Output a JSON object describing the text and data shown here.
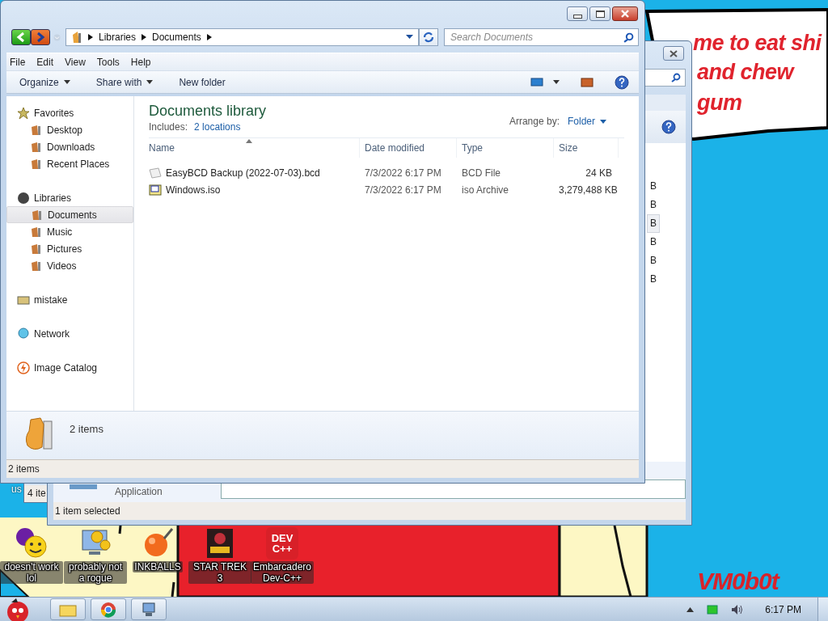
{
  "wallpaper": {
    "sign_lines": [
      "me to eat shi",
      "and chew",
      "gum"
    ],
    "signature": "VM0b0t"
  },
  "desktop": {
    "hidden_icon_label": "us",
    "icons": [
      {
        "label": "doesn't work lol"
      },
      {
        "label": "probably not a rogue"
      },
      {
        "label": "INKBALLS"
      },
      {
        "label": "STAR TREK 3"
      },
      {
        "label": "Embarcadero Dev-C++",
        "logo_text": [
          "DEV",
          "C++"
        ]
      }
    ]
  },
  "background_windows": [
    {
      "status": "4 ite"
    },
    {
      "details_text": "Application",
      "rows": [
        {
          "size_fragment": "B",
          "selected": false
        },
        {
          "size_fragment": "B",
          "selected": false
        },
        {
          "size_fragment": "B",
          "selected": true
        },
        {
          "size_fragment": "B",
          "selected": false
        },
        {
          "size_fragment": "B",
          "selected": false
        },
        {
          "size_fragment": "B",
          "selected": false
        }
      ],
      "status": "1 item selected"
    }
  ],
  "explorer": {
    "breadcrumb": [
      "Libraries",
      "Documents"
    ],
    "search_placeholder": "Search Documents",
    "menu": [
      "File",
      "Edit",
      "View",
      "Tools",
      "Help"
    ],
    "toolbar": [
      {
        "label": "Organize",
        "dropdown": true
      },
      {
        "label": "Share with",
        "dropdown": true
      },
      {
        "label": "New folder",
        "dropdown": false
      }
    ],
    "nav": [
      {
        "label": "Favorites",
        "selected": false,
        "children": [
          {
            "label": "Desktop",
            "selected": false
          },
          {
            "label": "Downloads",
            "selected": false
          },
          {
            "label": "Recent Places",
            "selected": false
          }
        ]
      },
      {
        "label": "Libraries",
        "selected": false,
        "children": [
          {
            "label": "Documents",
            "selected": true
          },
          {
            "label": "Music",
            "selected": false
          },
          {
            "label": "Pictures",
            "selected": false
          },
          {
            "label": "Videos",
            "selected": false
          }
        ]
      },
      {
        "label": "mistake",
        "selected": false
      },
      {
        "label": "Network",
        "selected": false
      },
      {
        "label": "Image Catalog",
        "selected": false
      }
    ],
    "library": {
      "title": "Documents library",
      "includes_label": "Includes:",
      "includes_link": "2 locations",
      "arrange_label": "Arrange by:",
      "arrange_value": "Folder"
    },
    "columns": [
      "Name",
      "Date modified",
      "Type",
      "Size"
    ],
    "files": [
      {
        "name": "EasyBCD Backup (2022-07-03).bcd",
        "date": "7/3/2022 6:17 PM",
        "type": "BCD File",
        "size": "24 KB"
      },
      {
        "name": "Windows.iso",
        "date": "7/3/2022 6:17 PM",
        "type": "iso Archive",
        "size": "3,279,488 KB"
      }
    ],
    "details": {
      "count": "2 items"
    },
    "status": "2 items"
  },
  "taskbar": {
    "time": "6:17 PM"
  }
}
